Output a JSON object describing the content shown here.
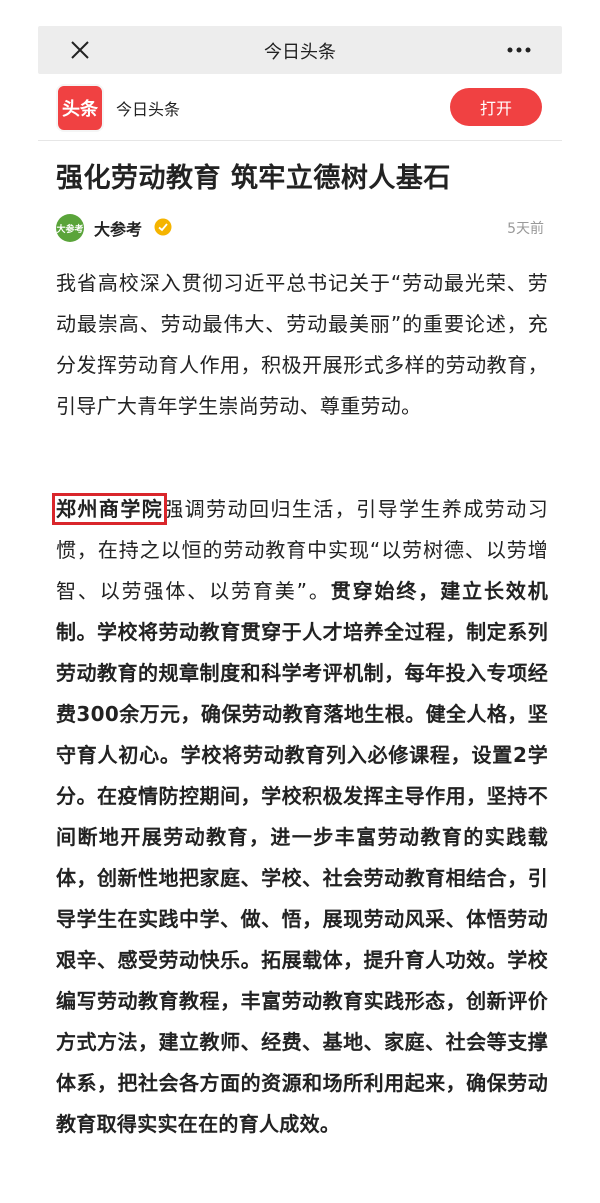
{
  "topbar": {
    "title": "今日头条",
    "left_icon": "close-icon",
    "right_icon": "more-icon"
  },
  "appbar": {
    "logo_text": "头条",
    "app_name": "今日头条",
    "open_label": "打开"
  },
  "article": {
    "title": "强化劳动教育 筑牢立德树人基石",
    "author": {
      "avatar_text": "大参考",
      "name": "大参考",
      "time": "5天前"
    },
    "paragraph1": "我省高校深入贯彻习近平总书记关于“劳动最光荣、劳动最崇高、劳动最伟大、劳动最美丽”的重要论述，充分发挥劳动育人作用，积极开展形式多样的劳动教育，引导广大青年学生崇尚劳动、尊重劳动。",
    "paragraph2": {
      "highlight": "郑州商学院",
      "s1": "强调劳动回归生活，引导学生养成劳动习惯，在持之以恒的劳动教育中实现“以劳树德、以劳增智、以劳强体、以劳育美”。",
      "s2": "贯穿始终，建立长效机制。学校将劳动教育贯穿于人才培养全过程，制定系列劳动教育的规章制度和科学考评机制，每年投入专项经费300余万元，确保劳动教育落地生根。健全人格，坚守育人初心。学校将劳动教育列入必修课程，设置2学分。在疫情防控期间，学校积极发挥主导作用，坚持不间断地开展劳动教育，进一步丰富劳动教育的实践载体，创新性地把家庭、学校、社会劳动教育相结合，引导学生在实践中学、做、悟，展现劳动风采、体悟劳动艰辛、感受劳动快乐。拓展载体，提升育人功效。学校编写劳动教育教程，丰富劳动教育实践形态，创新评价方式方法，建立教师、经费、基地、家庭、社会等支撑体系，把社会各方面的资源和场所利用起来，确保劳动教育取得实实在在的育人成效。"
    }
  },
  "colors": {
    "brand_red": "#f04142",
    "highlight_box": "#d9262b",
    "meta_gray": "#999999"
  }
}
